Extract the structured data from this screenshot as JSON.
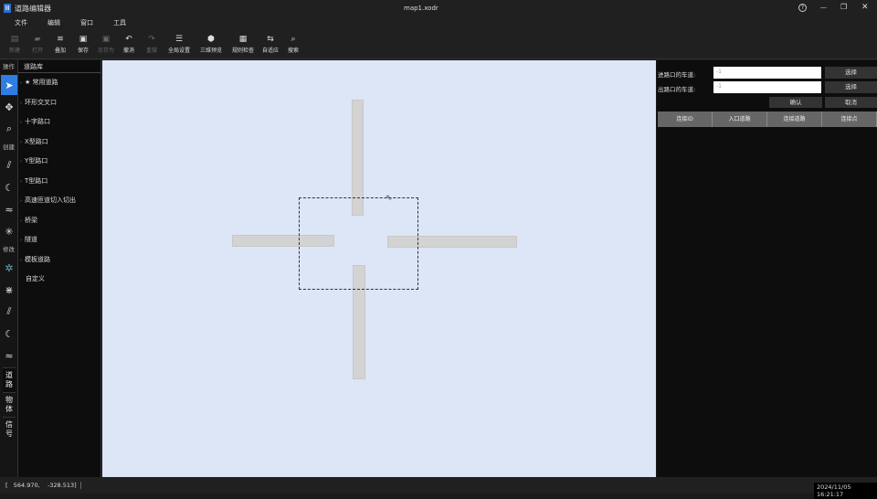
{
  "window": {
    "title": "道路编辑器",
    "file": "map1.xodr",
    "help": "?",
    "minimize": "—",
    "restore": "❐",
    "close": "✕"
  },
  "menu": [
    "文件",
    "编辑",
    "窗口",
    "工具"
  ],
  "toolbar": [
    {
      "label": "新建",
      "icon": "▤",
      "enabled": false
    },
    {
      "label": "打开",
      "icon": "▰",
      "enabled": false
    },
    {
      "label": "叠加",
      "icon": "≋",
      "enabled": true
    },
    {
      "label": "保存",
      "icon": "▣",
      "enabled": true
    },
    {
      "label": "另存为",
      "icon": "▣",
      "enabled": false
    },
    {
      "label": "撤消",
      "icon": "↶",
      "enabled": true
    },
    {
      "label": "重做",
      "icon": "↷",
      "enabled": false
    },
    {
      "label": "全局设置",
      "icon": "☰",
      "enabled": true
    },
    {
      "label": "三维预览",
      "icon": "⬢",
      "enabled": true
    },
    {
      "label": "规则检查",
      "icon": "▦",
      "enabled": true
    },
    {
      "label": "自适应",
      "icon": "⇆",
      "enabled": true
    },
    {
      "label": "搜索",
      "icon": "⌕",
      "enabled": true
    }
  ],
  "left_tools": {
    "op": "操作",
    "create": "创建",
    "modify": "修改"
  },
  "bottom_tabs": [
    "道路",
    "物体",
    "信号"
  ],
  "library": {
    "title": "道路库",
    "items": [
      "常用道路",
      "环形交叉口",
      "十字路口",
      "X型路口",
      "Y型路口",
      "T型路口",
      "高速匝道切入切出",
      "桥梁",
      "隧道",
      "模板道路",
      "自定义"
    ]
  },
  "panel": {
    "in_label": "进路口的车道:",
    "out_label": "出路口的车道:",
    "in_value": "-1",
    "out_value": "-1",
    "select": "选择",
    "confirm": "确认",
    "cancel": "取消",
    "columns": [
      "连接ID",
      "入口道路",
      "连接道路",
      "连接点"
    ]
  },
  "status": {
    "coords": "[   564.970,    -328.513]",
    "datetime": "2024/11/05 16:21:17"
  }
}
